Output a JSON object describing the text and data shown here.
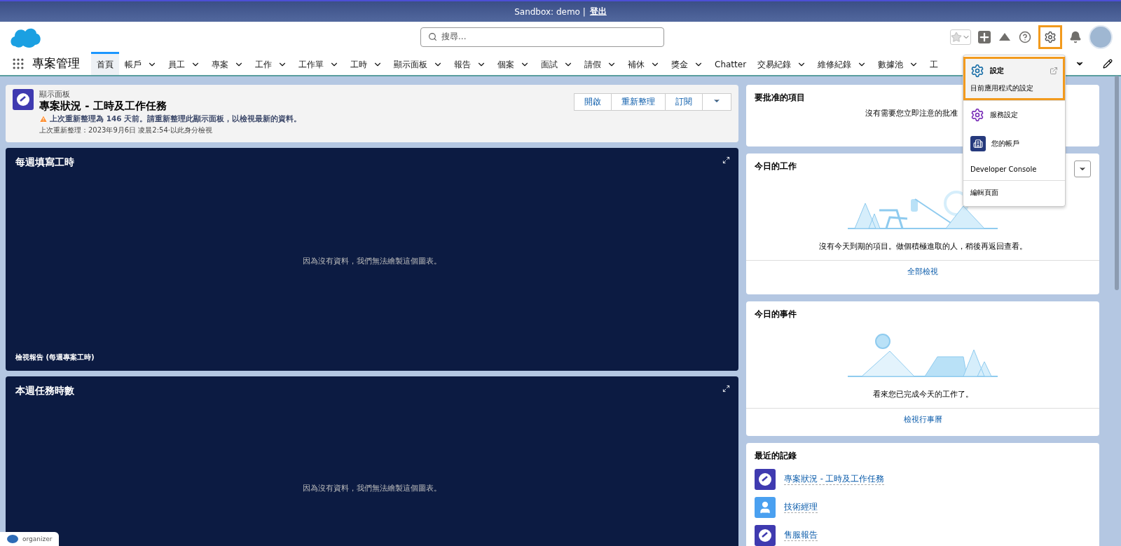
{
  "sandbox_bar": {
    "text": "Sandbox: demo |",
    "logout": "登出"
  },
  "search": {
    "placeholder": "搜尋..."
  },
  "header": {
    "setup_highlighted": true
  },
  "app": {
    "name": "專案管理"
  },
  "nav": [
    {
      "label": "首頁",
      "selected": true,
      "menu": false
    },
    {
      "label": "帳戶",
      "selected": false,
      "menu": true
    },
    {
      "label": "員工",
      "selected": false,
      "menu": true
    },
    {
      "label": "專案",
      "selected": false,
      "menu": true
    },
    {
      "label": "工作",
      "selected": false,
      "menu": true
    },
    {
      "label": "工作單",
      "selected": false,
      "menu": true
    },
    {
      "label": "工時",
      "selected": false,
      "menu": true
    },
    {
      "label": "顯示面板",
      "selected": false,
      "menu": true
    },
    {
      "label": "報告",
      "selected": false,
      "menu": true
    },
    {
      "label": "個案",
      "selected": false,
      "menu": true
    },
    {
      "label": "面試",
      "selected": false,
      "menu": true
    },
    {
      "label": "請假",
      "selected": false,
      "menu": true
    },
    {
      "label": "補休",
      "selected": false,
      "menu": true
    },
    {
      "label": "獎金",
      "selected": false,
      "menu": true
    },
    {
      "label": "Chatter",
      "selected": false,
      "menu": false
    },
    {
      "label": "交易紀錄",
      "selected": false,
      "menu": true
    },
    {
      "label": "維修紀錄",
      "selected": false,
      "menu": true
    },
    {
      "label": "數據池",
      "selected": false,
      "menu": true
    },
    {
      "label": "工",
      "selected": false,
      "menu": false
    }
  ],
  "setup_menu": [
    {
      "kind": "setup",
      "label": "設定",
      "sublabel": "目前應用程式的設定",
      "highlighted": true,
      "divider": false
    },
    {
      "kind": "service",
      "label": "服務設定",
      "highlighted": false,
      "divider": true
    },
    {
      "kind": "account",
      "label": "您的帳戶",
      "highlighted": false,
      "divider": false
    },
    {
      "kind": "plain",
      "label": "Developer Console",
      "highlighted": false,
      "divider": false
    },
    {
      "kind": "plain",
      "label": "編輯頁面",
      "highlighted": false,
      "divider": true
    }
  ],
  "dashboard": {
    "type_label": "顯示面板",
    "title": "專案狀況 - 工時及工作任務",
    "warning": "上次重新整理為 146 天前。請重新整理此顯示面板，以檢視最新的資料。",
    "refreshed": "上次重新整理：2023年9月6日 凌晨2:54·以此身分檢視",
    "buttons": [
      "開啟",
      "重新整理",
      "訂閱"
    ]
  },
  "charts": [
    {
      "title": "每週填寫工時",
      "message": "因為沒有資料，我們無法繪製這個圖表。",
      "footer": "檢視報告 (每週專案工時)"
    },
    {
      "title": "本週任務時數",
      "message": "因為沒有資料，我們無法繪製這個圖表。"
    }
  ],
  "approvals": {
    "title": "要批准的項目",
    "message": "沒有需要您立即注意的批准"
  },
  "tasks": {
    "title": "今日的工作",
    "message": "沒有今天到期的項目。做個積極進取的人，稍後再返回查看。",
    "link": "全部檢視"
  },
  "events": {
    "title": "今日的事件",
    "message": "看來您已完成今天的工作了。",
    "link": "檢視行事曆"
  },
  "recent": {
    "title": "最近的記錄",
    "items": [
      {
        "label": "專案狀況 - 工時及工作任務",
        "kind": "dashboard"
      },
      {
        "label": "技術經理",
        "kind": "person"
      },
      {
        "label": "售服報告",
        "kind": "dashboard"
      }
    ]
  },
  "organizer": {
    "label": "organizer"
  }
}
